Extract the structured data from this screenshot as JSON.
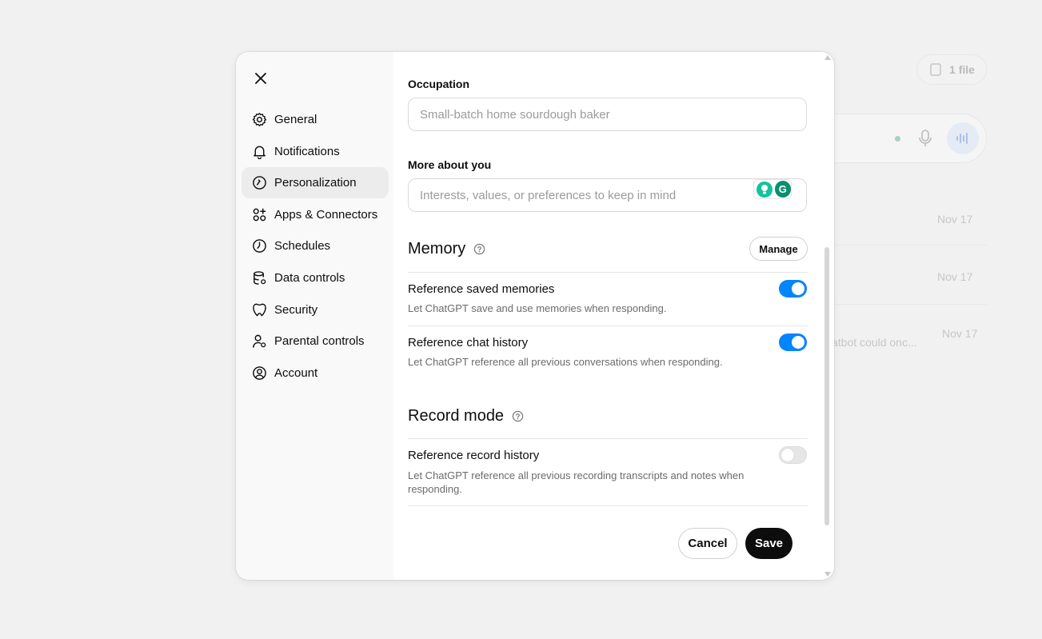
{
  "background": {
    "file_pill": "1 file",
    "dates": [
      "Nov 17",
      "Nov 17",
      "Nov 17"
    ],
    "snippet": "atbot could onc..."
  },
  "sidebar": {
    "items": [
      {
        "label": "General",
        "icon": "gear-icon"
      },
      {
        "label": "Notifications",
        "icon": "bell-icon"
      },
      {
        "label": "Personalization",
        "icon": "personalization-icon",
        "active": true
      },
      {
        "label": "Apps & Connectors",
        "icon": "apps-icon"
      },
      {
        "label": "Schedules",
        "icon": "clock-icon"
      },
      {
        "label": "Data controls",
        "icon": "database-icon"
      },
      {
        "label": "Security",
        "icon": "shield-icon"
      },
      {
        "label": "Parental controls",
        "icon": "parent-icon"
      },
      {
        "label": "Account",
        "icon": "account-icon"
      }
    ]
  },
  "form": {
    "occupation_label": "Occupation",
    "occupation_placeholder": "Small-batch home sourdough baker",
    "occupation_value": "",
    "more_label": "More about you",
    "more_placeholder": "Interests, values, or preferences to keep in mind",
    "more_value": ""
  },
  "memory": {
    "title": "Memory",
    "manage_label": "Manage",
    "rows": [
      {
        "title": "Reference saved memories",
        "desc": "Let ChatGPT save and use memories when responding.",
        "on": true
      },
      {
        "title": "Reference chat history",
        "desc": "Let ChatGPT reference all previous conversations when responding.",
        "on": true
      }
    ]
  },
  "record": {
    "title": "Record mode",
    "rows": [
      {
        "title": "Reference record history",
        "desc": "Let ChatGPT reference all previous recording transcripts and notes when responding.",
        "on": false
      }
    ]
  },
  "footer": {
    "cancel_label": "Cancel",
    "save_label": "Save"
  },
  "colors": {
    "toggle_on": "#0285ff",
    "save_bg": "#0d0d0d",
    "sidebar_bg": "#f9f9f9"
  }
}
